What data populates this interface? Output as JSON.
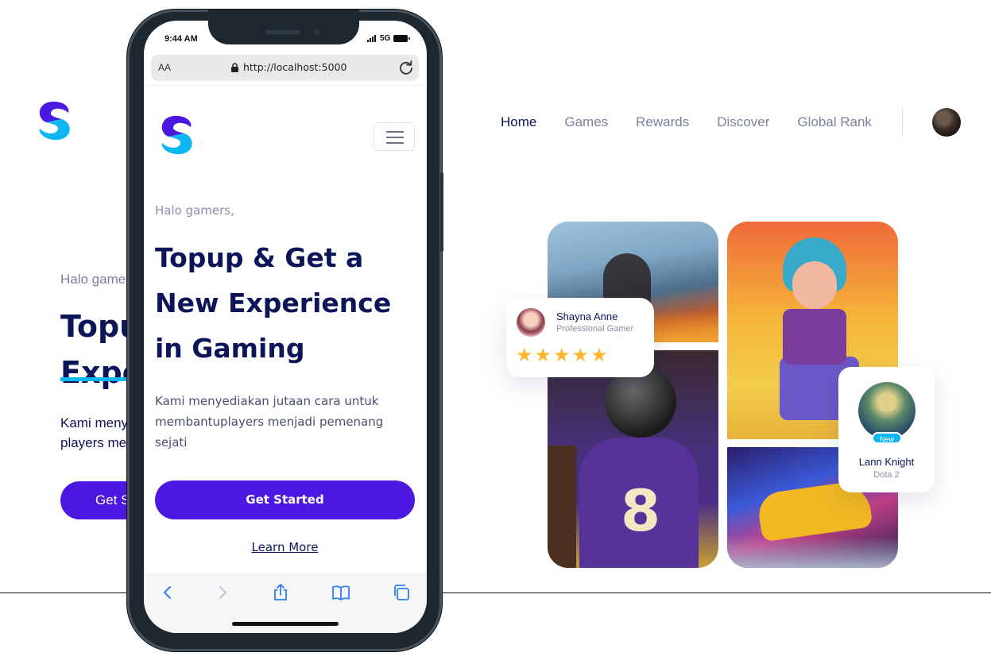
{
  "desktop": {
    "nav": [
      {
        "label": "Home",
        "active": true
      },
      {
        "label": "Games",
        "active": false
      },
      {
        "label": "Rewards",
        "active": false
      },
      {
        "label": "Discover",
        "active": false
      },
      {
        "label": "Global Rank",
        "active": false
      }
    ],
    "greeting": "Halo game",
    "title_line1": "Topu",
    "title_line2": "Expe",
    "desc_line1": "Kami meny",
    "desc_line2": "players me",
    "cta_label": "Get S"
  },
  "review_card": {
    "name": "Shayna Anne",
    "role": "Professional Gamer",
    "stars": "★★★★★",
    "rating": 5
  },
  "player_card": {
    "badge": "New",
    "name": "Lann Knight",
    "game": "Dota 2"
  },
  "phone": {
    "status": {
      "time": "9:44 AM",
      "network": "5G"
    },
    "browser": {
      "text_size_label": "AA",
      "url": "http://localhost:5000"
    },
    "greeting": "Halo gamers,",
    "title": "Topup & Get a New Experience in Gaming",
    "description": "Kami menyediakan jutaan cara untuk membantuplayers menjadi pemenang sejati",
    "cta_label": "Get Started",
    "learn_more_label": "Learn More"
  },
  "colors": {
    "primary": "#4d17e2",
    "navy": "#0c145a",
    "accent": "#0bb7f2",
    "muted": "#7d819c",
    "star": "#ffb731"
  },
  "icons": [
    "logo-icon",
    "avatar",
    "menu-icon",
    "lock-icon",
    "reload-icon",
    "back-icon",
    "forward-icon",
    "share-icon",
    "bookmarks-icon",
    "tabs-icon",
    "star-icon"
  ]
}
